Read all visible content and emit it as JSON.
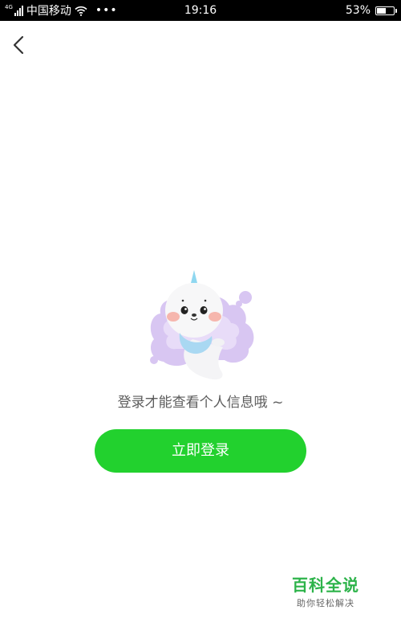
{
  "status_bar": {
    "network": "4G",
    "carrier": "中国移动",
    "dots": "•••",
    "time": "19:16",
    "battery_percent_label": "53%",
    "battery_level": 0.53
  },
  "content": {
    "prompt": "登录才能查看个人信息哦 ~",
    "login_button_label": "立即登录"
  },
  "watermark": {
    "title": "百科全说",
    "subtitle": "助你轻松解决"
  },
  "colors": {
    "accent": "#22d12e",
    "watermark": "#2db34a",
    "mascot_cloud": "#d8c6f2"
  }
}
